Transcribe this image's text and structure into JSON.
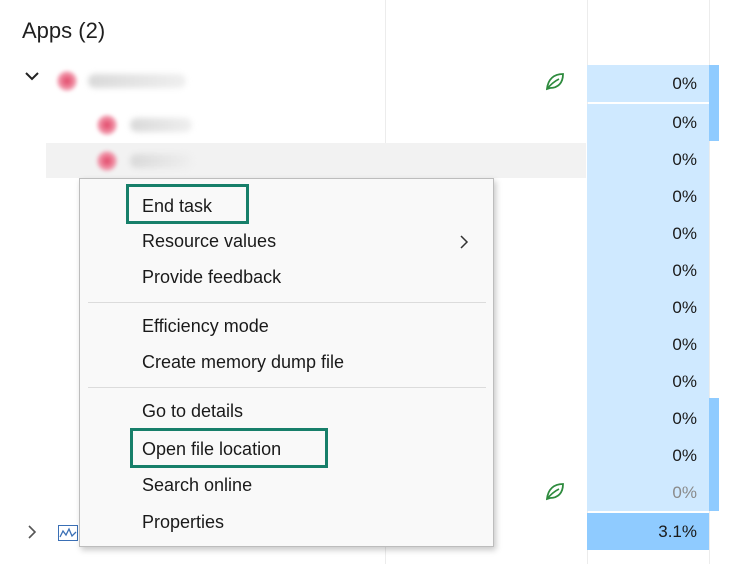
{
  "apps_heading": "Apps (2)",
  "colors": {
    "accent_box": "#177f6a",
    "cpu_fill": "#cfe9ff",
    "cpu_total_fill": "#8fcbff",
    "leaf": "#2e8b3e"
  },
  "icons": [
    "chevron-down-icon",
    "chevron-right-icon",
    "firefox-icon",
    "efficiency-leaf-icon",
    "performance-graph-icon",
    "submenu-arrow-icon"
  ],
  "cpu_values": [
    "0%",
    "0%",
    "0%",
    "0%",
    "0%",
    "0%",
    "0%",
    "0%",
    "0%",
    "0%",
    "0%",
    "0%",
    "3.1%"
  ],
  "context_menu": {
    "end_task": "End task",
    "resource_values": "Resource values",
    "provide_feedback": "Provide feedback",
    "efficiency_mode": "Efficiency mode",
    "create_memory_dump": "Create memory dump file",
    "go_to_details": "Go to details",
    "open_file_location": "Open file location",
    "search_online": "Search online",
    "properties": "Properties"
  }
}
